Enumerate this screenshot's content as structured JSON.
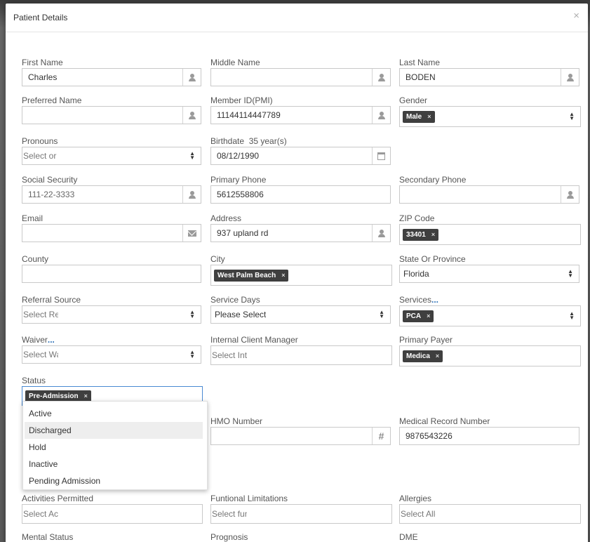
{
  "modal": {
    "title": "Patient Details",
    "close": "×"
  },
  "fields": {
    "first_name": {
      "label": "First Name",
      "value": "Charles"
    },
    "middle_name": {
      "label": "Middle Name",
      "value": ""
    },
    "last_name": {
      "label": "Last Name",
      "value": "BODEN"
    },
    "preferred_name": {
      "label": "Preferred Name",
      "value": ""
    },
    "member_id": {
      "label": "Member ID(PMI)",
      "value": "11144114447789"
    },
    "gender": {
      "label": "Gender",
      "tag": "Male"
    },
    "pronouns": {
      "label": "Pronouns",
      "placeholder": "Select or ("
    },
    "birthdate": {
      "label": "Birthdate",
      "age": "35 year(s)",
      "value": "08/12/1990"
    },
    "social_security": {
      "label": "Social Security",
      "value": "111-22-3333"
    },
    "primary_phone": {
      "label": "Primary Phone",
      "value": "5612558806"
    },
    "secondary_phone": {
      "label": "Secondary Phone",
      "value": ""
    },
    "email": {
      "label": "Email",
      "value": ""
    },
    "address": {
      "label": "Address",
      "value": "937 upland rd"
    },
    "zip_code": {
      "label": "ZIP Code",
      "tag": "33401"
    },
    "county": {
      "label": "County",
      "value": ""
    },
    "city": {
      "label": "City",
      "tag": "West Palm Beach"
    },
    "state": {
      "label": "State Or Province",
      "value": "Florida"
    },
    "referral_source": {
      "label": "Referral Source",
      "placeholder": "Select Ref"
    },
    "service_days": {
      "label": "Service Days",
      "value": "Please Select"
    },
    "services": {
      "label": "Services",
      "more": "...",
      "tag": "PCA"
    },
    "waiver": {
      "label": "Waiver",
      "more": "...",
      "placeholder": "Select Wa"
    },
    "internal_client_manager": {
      "label": "Internal Client Manager",
      "placeholder": "Select Int"
    },
    "primary_payer": {
      "label": "Primary Payer",
      "tag": "Medica"
    },
    "status": {
      "label": "Status",
      "tag": "Pre-Admission"
    },
    "hmo_number": {
      "label": "HMO Number",
      "value": ""
    },
    "medical_record_number": {
      "label": "Medical Record Number",
      "value": "9876543226"
    },
    "activities_permitted": {
      "label": "Activities Permitted",
      "placeholder": "Select Act"
    },
    "functional_limitations": {
      "label": "Funtional Limitations",
      "placeholder": "Select fun"
    },
    "allergies": {
      "label": "Allergies",
      "placeholder": "Select Alle"
    },
    "mental_status": {
      "label": "Mental Status"
    },
    "prognosis": {
      "label": "Prognosis"
    },
    "dme": {
      "label": "DME"
    }
  },
  "status_dropdown": {
    "options": [
      "Active",
      "Discharged",
      "Hold",
      "Inactive",
      "Pending Admission"
    ],
    "highlighted": "Discharged"
  },
  "icons": {
    "person": "user-icon",
    "calendar": "calendar-icon",
    "envelope": "envelope-icon",
    "hash": "hash-icon",
    "tag_remove": "×"
  },
  "colors": {
    "tag_bg": "#3f3f3f",
    "focus_border": "#4a8ad3",
    "link": "#2a6fb6"
  }
}
